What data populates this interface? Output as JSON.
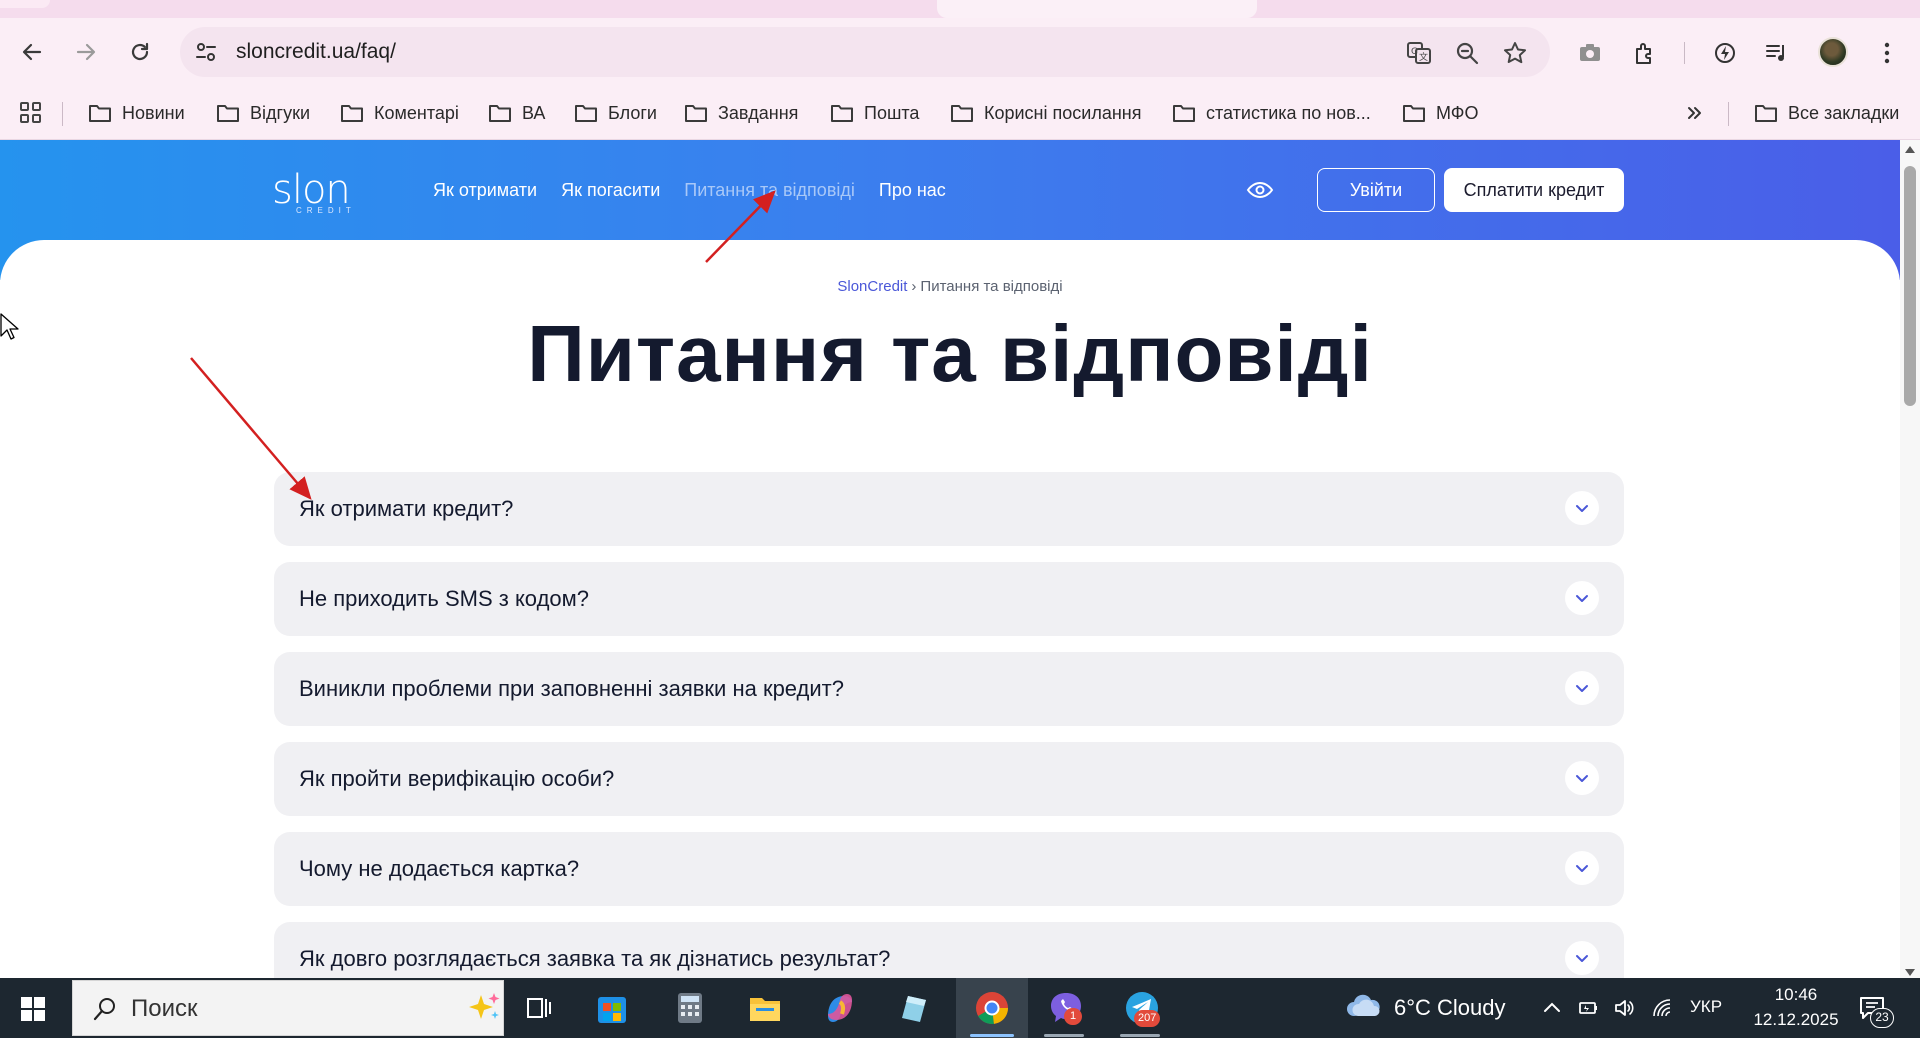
{
  "browser": {
    "url": "sloncredit.ua/faq/",
    "bookmarks": [
      {
        "label": "Новини"
      },
      {
        "label": "Відгуки"
      },
      {
        "label": "Коментарі"
      },
      {
        "label": "ВА"
      },
      {
        "label": "Блоги"
      },
      {
        "label": "Завдання"
      },
      {
        "label": "Пошта"
      },
      {
        "label": "Корисні посилання"
      },
      {
        "label": "статистика по нов..."
      },
      {
        "label": "МФО"
      }
    ],
    "all_bookmarks_label": "Все закладки"
  },
  "site": {
    "logo_text": "slon",
    "logo_sub": "CREDIT",
    "nav": [
      {
        "label": "Як отримати"
      },
      {
        "label": "Як погасити"
      },
      {
        "label": "Питання та відповіді"
      },
      {
        "label": "Про нас"
      }
    ],
    "login_label": "Увійти",
    "pay_label": "Сплатити кредит",
    "breadcrumb": {
      "home": "SlonCredit",
      "current": "Питання та відповіді"
    },
    "page_title": "Питання та відповіді",
    "faq": [
      {
        "question": "Як отримати кредит?"
      },
      {
        "question": "Не приходить SMS з кодом?"
      },
      {
        "question": "Виникли проблеми при заповненні заявки на кредит?"
      },
      {
        "question": "Як пройти верифікацію особи?"
      },
      {
        "question": "Чому не додається картка?"
      },
      {
        "question": "Як довго розглядається заявка та як дізнатись результат?"
      }
    ],
    "colors": {
      "header_start": "#2593ee",
      "header_end": "#4a5ee8",
      "faq_bg": "#f0f0f3",
      "accent": "#4a57d8",
      "annotation": "#d32020"
    }
  },
  "taskbar": {
    "search_placeholder": "Поиск",
    "weather": "6°C  Cloudy",
    "language": "УКР",
    "time": "10:46",
    "date": "12.12.2025",
    "viber_badge": "1",
    "telegram_badge": "207",
    "notifications_badge": "23"
  }
}
